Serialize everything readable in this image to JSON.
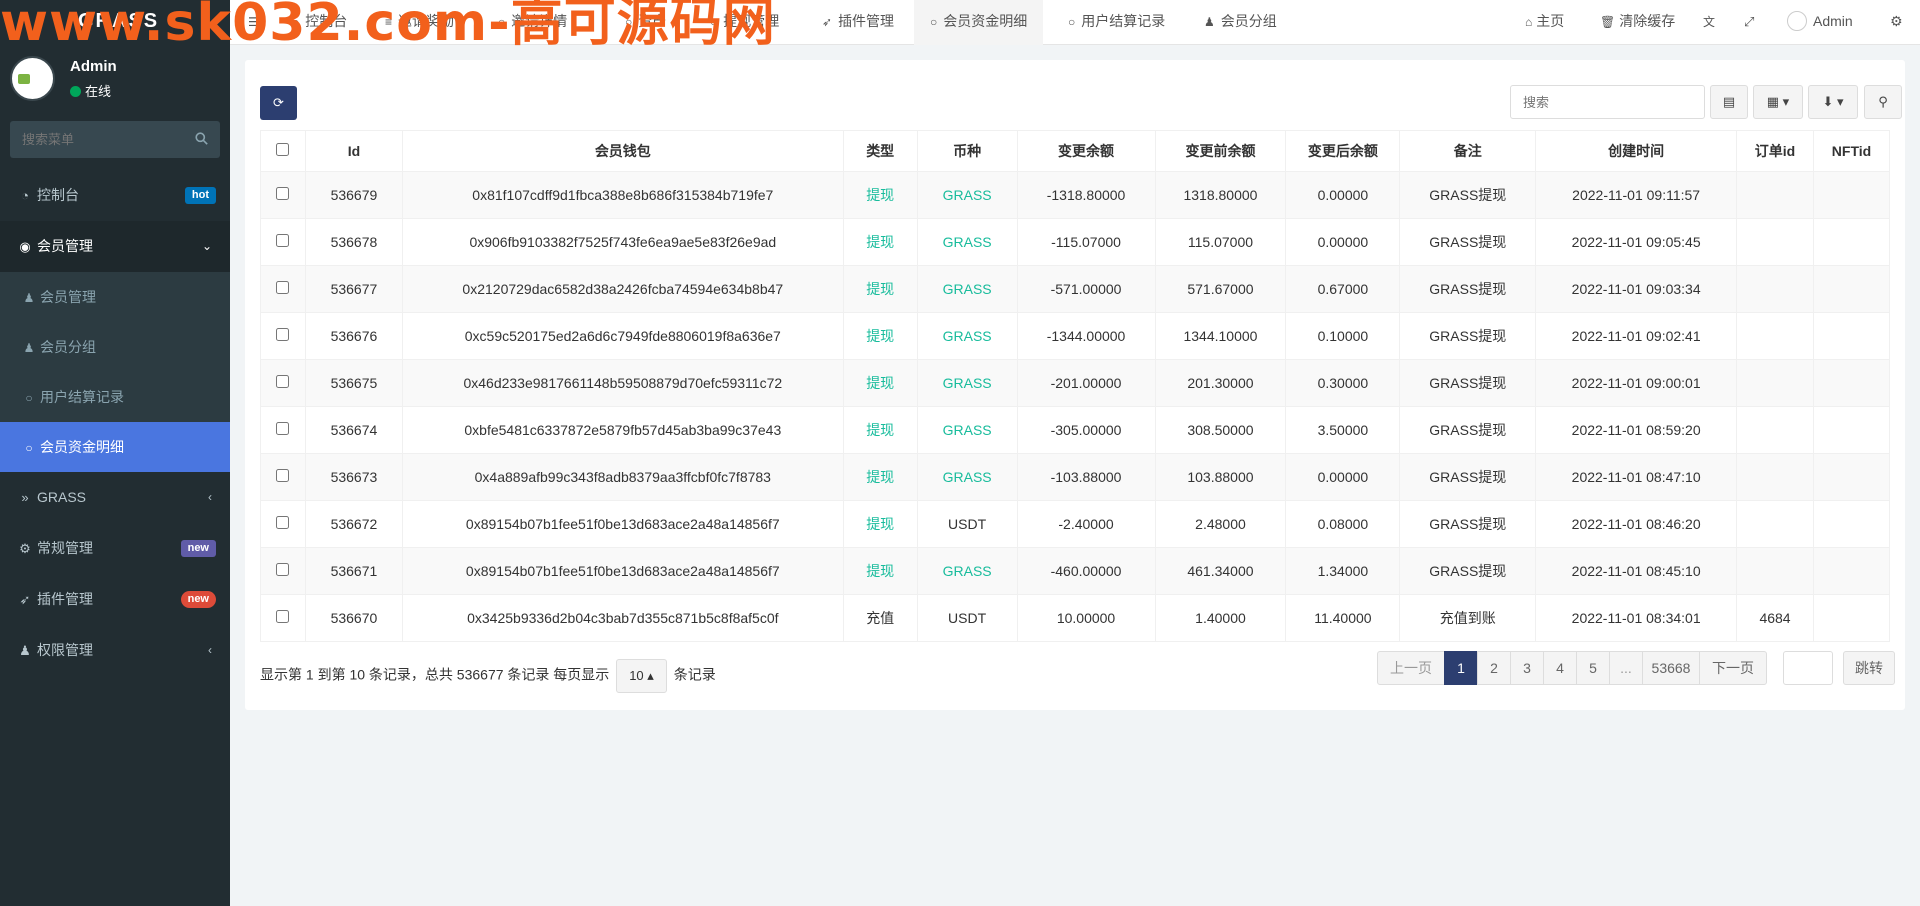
{
  "watermark": "www.sk032.com-高可源码网",
  "app": {
    "logo": "GRASS"
  },
  "user": {
    "name": "Admin",
    "status": "在线"
  },
  "sidebar": {
    "search_placeholder": "搜索菜单",
    "items": [
      {
        "label": "控制台",
        "icon": "dashboard-icon",
        "badge": "hot"
      },
      {
        "label": "会员管理",
        "icon": "user-circle-icon"
      },
      {
        "label": "GRASS",
        "icon": "angle-double-right-icon"
      },
      {
        "label": "常规管理",
        "icon": "cogs-icon",
        "badge": "new"
      },
      {
        "label": "插件管理",
        "icon": "rocket-icon",
        "badge": "new"
      },
      {
        "label": "权限管理",
        "icon": "users-icon"
      }
    ],
    "submenu": [
      {
        "label": "会员管理",
        "icon": "user-icon"
      },
      {
        "label": "会员分组",
        "icon": "users-icon"
      },
      {
        "label": "用户结算记录",
        "icon": "circle-icon"
      },
      {
        "label": "会员资金明细",
        "icon": "circle-icon"
      }
    ]
  },
  "topnav": {
    "tabs": [
      {
        "label": "控制台",
        "icon": "dashboard-icon"
      },
      {
        "label": "邀请奖励",
        "icon": "list-icon"
      },
      {
        "label": "邀请详情",
        "icon": "circle-icon"
      },
      {
        "label": "资产",
        "icon": "circle-icon"
      },
      {
        "label": "提现管理",
        "icon": "circle-icon"
      },
      {
        "label": "插件管理",
        "icon": "rocket-icon"
      },
      {
        "label": "会员资金明细",
        "icon": "circle-icon"
      },
      {
        "label": "用户结算记录",
        "icon": "circle-icon"
      },
      {
        "label": "会员分组",
        "icon": "users-icon"
      }
    ],
    "right": {
      "home": "主页",
      "clear_cache": "清除缓存",
      "admin": "Admin"
    }
  },
  "toolbar": {
    "search_placeholder": "搜索"
  },
  "table": {
    "columns": [
      "Id",
      "会员钱包",
      "类型",
      "币种",
      "变更余额",
      "变更前余额",
      "变更后余额",
      "备注",
      "创建时间",
      "订单id",
      "NFTid"
    ],
    "rows": [
      [
        "536679",
        "0x81f107cdff9d1fbca388e8b686f315384b719fe7",
        "提现",
        "GRASS",
        "-1318.80000",
        "1318.80000",
        "0.00000",
        "GRASS提现",
        "2022-11-01 09:11:57",
        "",
        ""
      ],
      [
        "536678",
        "0x906fb9103382f7525f743fe6ea9ae5e83f26e9ad",
        "提现",
        "GRASS",
        "-115.07000",
        "115.07000",
        "0.00000",
        "GRASS提现",
        "2022-11-01 09:05:45",
        "",
        ""
      ],
      [
        "536677",
        "0x2120729dac6582d38a2426fcba74594e634b8b47",
        "提现",
        "GRASS",
        "-571.00000",
        "571.67000",
        "0.67000",
        "GRASS提现",
        "2022-11-01 09:03:34",
        "",
        ""
      ],
      [
        "536676",
        "0xc59c520175ed2a6d6c7949fde8806019f8a636e7",
        "提现",
        "GRASS",
        "-1344.00000",
        "1344.10000",
        "0.10000",
        "GRASS提现",
        "2022-11-01 09:02:41",
        "",
        ""
      ],
      [
        "536675",
        "0x46d233e9817661148b59508879d70efc59311c72",
        "提现",
        "GRASS",
        "-201.00000",
        "201.30000",
        "0.30000",
        "GRASS提现",
        "2022-11-01 09:00:01",
        "",
        ""
      ],
      [
        "536674",
        "0xbfe5481c6337872e5879fb57d45ab3ba99c37e43",
        "提现",
        "GRASS",
        "-305.00000",
        "308.50000",
        "3.50000",
        "GRASS提现",
        "2022-11-01 08:59:20",
        "",
        ""
      ],
      [
        "536673",
        "0x4a889afb99c343f8adb8379aa3ffcbf0fc7f8783",
        "提现",
        "GRASS",
        "-103.88000",
        "103.88000",
        "0.00000",
        "GRASS提现",
        "2022-11-01 08:47:10",
        "",
        ""
      ],
      [
        "536672",
        "0x89154b07b1fee51f0be13d683ace2a48a14856f7",
        "提现",
        "USDT",
        "-2.40000",
        "2.48000",
        "0.08000",
        "GRASS提现",
        "2022-11-01 08:46:20",
        "",
        ""
      ],
      [
        "536671",
        "0x89154b07b1fee51f0be13d683ace2a48a14856f7",
        "提现",
        "GRASS",
        "-460.00000",
        "461.34000",
        "1.34000",
        "GRASS提现",
        "2022-11-01 08:45:10",
        "",
        ""
      ],
      [
        "536670",
        "0x3425b9336d2b04c3bab7d355c871b5c8f8af5c0f",
        "充值",
        "USDT",
        "10.00000",
        "1.40000",
        "11.40000",
        "充值到账",
        "2022-11-01 08:34:01",
        "4684",
        ""
      ]
    ]
  },
  "footer": {
    "info_prefix": "显示第 1 到第 10 条记录，总共 536677 条记录 每页显示",
    "page_size": "10",
    "info_suffix": "条记录"
  },
  "pagination": {
    "prev": "上一页",
    "pages": [
      "1",
      "2",
      "3",
      "4",
      "5",
      "...",
      "53668"
    ],
    "next": "下一页",
    "jump": "跳转"
  },
  "colors": {
    "accent": "#2c3e70",
    "sidebar_bg": "#222d32",
    "active_menu": "#4a76e0",
    "green_text": "#18bc9c",
    "watermark": "#f2601c"
  }
}
